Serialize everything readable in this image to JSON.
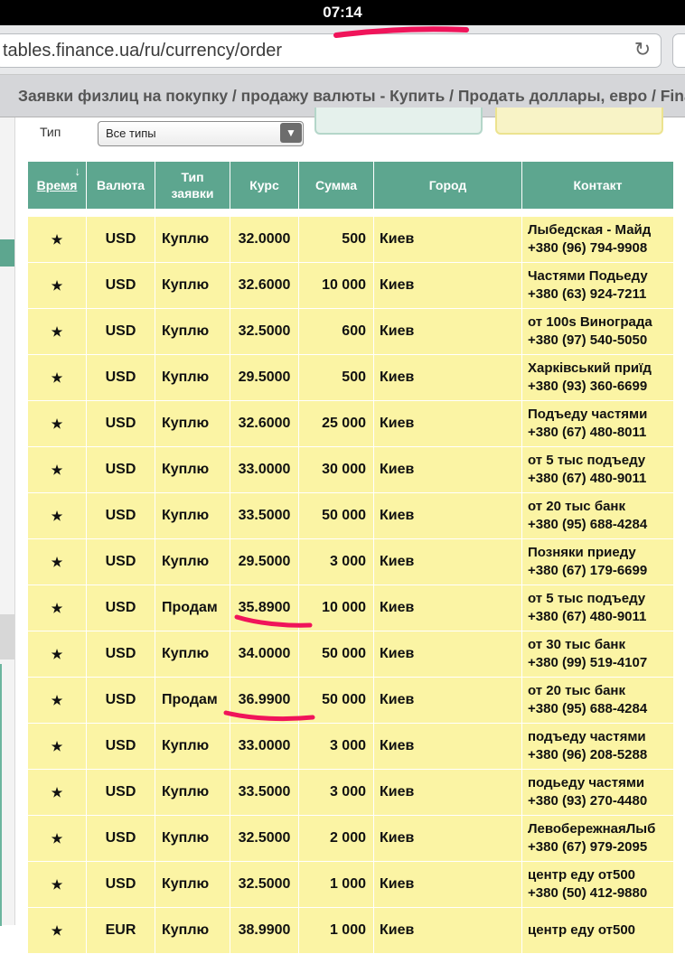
{
  "status": {
    "time": "07:14"
  },
  "browser": {
    "url": "tables.finance.ua/ru/currency/order",
    "tab_title": "Заявки физлиц на покупку / продажу валюты - Купить / Продать доллары, евро / Fina"
  },
  "filter": {
    "label": "Тип",
    "selected": "Все типы"
  },
  "columns": {
    "time": "Время",
    "currency": "Валюта",
    "type": "Тип заявки",
    "rate": "Курс",
    "sum": "Сумма",
    "city": "Город",
    "contact": "Контакт"
  },
  "rows": [
    {
      "star": "★",
      "currency": "USD",
      "type": "Куплю",
      "rate": "32.0000",
      "sum": "500",
      "city": "Киев",
      "contact1": "Лыбедская - Майд",
      "contact2": "+380 (96) 794-9908"
    },
    {
      "star": "★",
      "currency": "USD",
      "type": "Куплю",
      "rate": "32.6000",
      "sum": "10 000",
      "city": "Киев",
      "contact1": "Частями Подьеду",
      "contact2": "+380 (63) 924-7211"
    },
    {
      "star": "★",
      "currency": "USD",
      "type": "Куплю",
      "rate": "32.5000",
      "sum": "600",
      "city": "Киев",
      "contact1": "от 100s Винограда",
      "contact2": "+380 (97) 540-5050"
    },
    {
      "star": "★",
      "currency": "USD",
      "type": "Куплю",
      "rate": "29.5000",
      "sum": "500",
      "city": "Киев",
      "contact1": "Харківський приїд",
      "contact2": "+380 (93) 360-6699"
    },
    {
      "star": "★",
      "currency": "USD",
      "type": "Куплю",
      "rate": "32.6000",
      "sum": "25 000",
      "city": "Киев",
      "contact1": "Подъеду частями",
      "contact2": "+380 (67) 480-8011"
    },
    {
      "star": "★",
      "currency": "USD",
      "type": "Куплю",
      "rate": "33.0000",
      "sum": "30 000",
      "city": "Киев",
      "contact1": "от 5 тыс подъеду",
      "contact2": "+380 (67) 480-9011"
    },
    {
      "star": "★",
      "currency": "USD",
      "type": "Куплю",
      "rate": "33.5000",
      "sum": "50 000",
      "city": "Киев",
      "contact1": "от 20 тыс банк",
      "contact2": "+380 (95) 688-4284"
    },
    {
      "star": "★",
      "currency": "USD",
      "type": "Куплю",
      "rate": "29.5000",
      "sum": "3 000",
      "city": "Киев",
      "contact1": "Позняки приеду",
      "contact2": "+380 (67) 179-6699"
    },
    {
      "star": "★",
      "currency": "USD",
      "type": "Продам",
      "rate": "35.8900",
      "sum": "10 000",
      "city": "Киев",
      "contact1": "от 5 тыс подъеду",
      "contact2": "+380 (67) 480-9011"
    },
    {
      "star": "★",
      "currency": "USD",
      "type": "Куплю",
      "rate": "34.0000",
      "sum": "50 000",
      "city": "Киев",
      "contact1": "от 30 тыс банк",
      "contact2": "+380 (99) 519-4107"
    },
    {
      "star": "★",
      "currency": "USD",
      "type": "Продам",
      "rate": "36.9900",
      "sum": "50 000",
      "city": "Киев",
      "contact1": "от 20 тыс банк",
      "contact2": "+380 (95) 688-4284"
    },
    {
      "star": "★",
      "currency": "USD",
      "type": "Куплю",
      "rate": "33.0000",
      "sum": "3 000",
      "city": "Киев",
      "contact1": "подъеду частями",
      "contact2": "+380 (96) 208-5288"
    },
    {
      "star": "★",
      "currency": "USD",
      "type": "Куплю",
      "rate": "33.5000",
      "sum": "3 000",
      "city": "Киев",
      "contact1": "подьеду частями",
      "contact2": "+380 (93) 270-4480"
    },
    {
      "star": "★",
      "currency": "USD",
      "type": "Куплю",
      "rate": "32.5000",
      "sum": "2 000",
      "city": "Киев",
      "contact1": "ЛевобережнаяЛыб",
      "contact2": "+380 (67) 979-2095"
    },
    {
      "star": "★",
      "currency": "USD",
      "type": "Куплю",
      "rate": "32.5000",
      "sum": "1 000",
      "city": "Киев",
      "contact1": "центр еду от500",
      "contact2": "+380 (50) 412-9880"
    },
    {
      "star": "★",
      "currency": "EUR",
      "type": "Куплю",
      "rate": "38.9900",
      "sum": "1 000",
      "city": "Киев",
      "contact1": "центр еду от500",
      "contact2": ""
    }
  ]
}
